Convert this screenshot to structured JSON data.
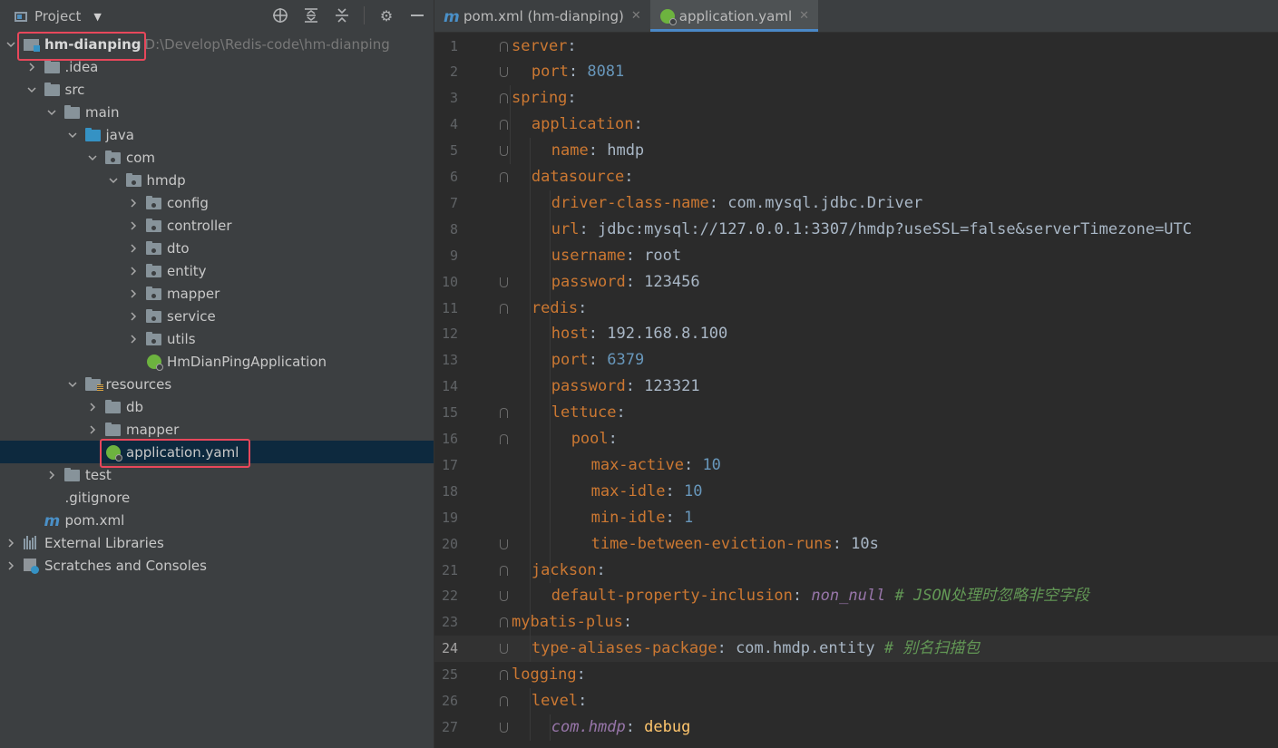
{
  "project_panel": {
    "title": "Project",
    "tree": [
      {
        "label": "hm-dianping",
        "path": "D:\\Develop\\Redis-code\\hm-dianping",
        "indent": 0,
        "arrow": "open",
        "icon": "module-folder-icon",
        "bold": true
      },
      {
        "label": ".idea",
        "indent": 1,
        "arrow": "closed",
        "icon": "folder-icon"
      },
      {
        "label": "src",
        "indent": 1,
        "arrow": "open",
        "icon": "folder-icon"
      },
      {
        "label": "main",
        "indent": 2,
        "arrow": "open",
        "icon": "folder-icon"
      },
      {
        "label": "java",
        "indent": 3,
        "arrow": "open",
        "icon": "source-folder-icon"
      },
      {
        "label": "com",
        "indent": 4,
        "arrow": "open",
        "icon": "package-icon"
      },
      {
        "label": "hmdp",
        "indent": 5,
        "arrow": "open",
        "icon": "package-icon"
      },
      {
        "label": "config",
        "indent": 6,
        "arrow": "closed",
        "icon": "package-icon"
      },
      {
        "label": "controller",
        "indent": 6,
        "arrow": "closed",
        "icon": "package-icon"
      },
      {
        "label": "dto",
        "indent": 6,
        "arrow": "closed",
        "icon": "package-icon"
      },
      {
        "label": "entity",
        "indent": 6,
        "arrow": "closed",
        "icon": "package-icon"
      },
      {
        "label": "mapper",
        "indent": 6,
        "arrow": "closed",
        "icon": "package-icon"
      },
      {
        "label": "service",
        "indent": 6,
        "arrow": "closed",
        "icon": "package-icon"
      },
      {
        "label": "utils",
        "indent": 6,
        "arrow": "closed",
        "icon": "package-icon"
      },
      {
        "label": "HmDianPingApplication",
        "indent": 6,
        "arrow": "none",
        "icon": "spring-boot-app-icon"
      },
      {
        "label": "resources",
        "indent": 3,
        "arrow": "open",
        "icon": "resources-folder-icon"
      },
      {
        "label": "db",
        "indent": 4,
        "arrow": "closed",
        "icon": "folder-icon"
      },
      {
        "label": "mapper",
        "indent": 4,
        "arrow": "closed",
        "icon": "folder-icon"
      },
      {
        "label": "application.yaml",
        "indent": 4,
        "arrow": "none",
        "icon": "spring-yaml-icon",
        "selected": true
      },
      {
        "label": "test",
        "indent": 2,
        "arrow": "closed",
        "icon": "folder-icon"
      },
      {
        "label": ".gitignore",
        "indent": 1,
        "arrow": "none",
        "icon": "gitignore-file-icon"
      },
      {
        "label": "pom.xml",
        "indent": 1,
        "arrow": "none",
        "icon": "maven-icon"
      },
      {
        "label": "External Libraries",
        "indent": 0,
        "arrow": "closed",
        "icon": "libraries-icon"
      },
      {
        "label": "Scratches and Consoles",
        "indent": 0,
        "arrow": "closed",
        "icon": "scratches-icon"
      }
    ]
  },
  "tabs": [
    {
      "label": "pom.xml (hm-dianping)",
      "icon": "maven-icon",
      "active": false
    },
    {
      "label": "application.yaml",
      "icon": "spring-yaml-icon",
      "active": true
    }
  ],
  "editor": {
    "current_line": 24,
    "lines": [
      {
        "n": "1",
        "indent": 0,
        "parts": [
          [
            "k",
            "server"
          ],
          [
            "s",
            ":"
          ]
        ]
      },
      {
        "n": "2",
        "indent": 1,
        "parts": [
          [
            "k",
            "port"
          ],
          [
            "s",
            ": "
          ],
          [
            "n",
            "8081"
          ]
        ]
      },
      {
        "n": "3",
        "indent": 0,
        "parts": [
          [
            "k",
            "spring"
          ],
          [
            "s",
            ":"
          ]
        ]
      },
      {
        "n": "4",
        "indent": 1,
        "parts": [
          [
            "k",
            "application"
          ],
          [
            "s",
            ":"
          ]
        ]
      },
      {
        "n": "5",
        "indent": 2,
        "parts": [
          [
            "k",
            "name"
          ],
          [
            "s",
            ": hmdp"
          ]
        ]
      },
      {
        "n": "6",
        "indent": 1,
        "parts": [
          [
            "k",
            "datasource"
          ],
          [
            "s",
            ":"
          ]
        ]
      },
      {
        "n": "7",
        "indent": 2,
        "parts": [
          [
            "k",
            "driver-class-name"
          ],
          [
            "s",
            ": com.mysql.jdbc.Driver"
          ]
        ]
      },
      {
        "n": "8",
        "indent": 2,
        "parts": [
          [
            "k",
            "url"
          ],
          [
            "s",
            ": jdbc:mysql://127.0.0.1:3307/hmdp?useSSL=false&serverTimezone=UTC"
          ]
        ]
      },
      {
        "n": "9",
        "indent": 2,
        "parts": [
          [
            "k",
            "username"
          ],
          [
            "s",
            ": root"
          ]
        ]
      },
      {
        "n": "10",
        "indent": 2,
        "parts": [
          [
            "k",
            "password"
          ],
          [
            "s",
            ": 123456"
          ]
        ]
      },
      {
        "n": "11",
        "indent": 1,
        "parts": [
          [
            "k",
            "redis"
          ],
          [
            "s",
            ":"
          ]
        ]
      },
      {
        "n": "12",
        "indent": 2,
        "parts": [
          [
            "k",
            "host"
          ],
          [
            "s",
            ": 192.168.8.100"
          ]
        ]
      },
      {
        "n": "13",
        "indent": 2,
        "parts": [
          [
            "k",
            "port"
          ],
          [
            "s",
            ": "
          ],
          [
            "n",
            "6379"
          ]
        ]
      },
      {
        "n": "14",
        "indent": 2,
        "parts": [
          [
            "k",
            "password"
          ],
          [
            "s",
            ": 123321"
          ]
        ]
      },
      {
        "n": "15",
        "indent": 2,
        "parts": [
          [
            "k",
            "lettuce"
          ],
          [
            "s",
            ":"
          ]
        ]
      },
      {
        "n": "16",
        "indent": 3,
        "parts": [
          [
            "k",
            "pool"
          ],
          [
            "s",
            ":"
          ]
        ]
      },
      {
        "n": "17",
        "indent": 4,
        "parts": [
          [
            "k",
            "max-active"
          ],
          [
            "s",
            ": "
          ],
          [
            "n",
            "10"
          ]
        ]
      },
      {
        "n": "18",
        "indent": 4,
        "parts": [
          [
            "k",
            "max-idle"
          ],
          [
            "s",
            ": "
          ],
          [
            "n",
            "10"
          ]
        ]
      },
      {
        "n": "19",
        "indent": 4,
        "parts": [
          [
            "k",
            "min-idle"
          ],
          [
            "s",
            ": "
          ],
          [
            "n",
            "1"
          ]
        ]
      },
      {
        "n": "20",
        "indent": 4,
        "parts": [
          [
            "k",
            "time-between-eviction-runs"
          ],
          [
            "s",
            ": 10s"
          ]
        ]
      },
      {
        "n": "21",
        "indent": 1,
        "parts": [
          [
            "k",
            "jackson"
          ],
          [
            "s",
            ":"
          ]
        ]
      },
      {
        "n": "22",
        "indent": 2,
        "parts": [
          [
            "k",
            "default-property-inclusion"
          ],
          [
            "s",
            ": "
          ],
          [
            "ital",
            "non_null"
          ],
          [
            "c",
            " # JSON处理时忽略非空字段"
          ]
        ]
      },
      {
        "n": "23",
        "indent": 0,
        "parts": [
          [
            "k",
            "mybatis-plus"
          ],
          [
            "s",
            ":"
          ]
        ]
      },
      {
        "n": "24",
        "indent": 1,
        "parts": [
          [
            "k",
            "type-aliases-package"
          ],
          [
            "s",
            ": com.hmdp.entity"
          ],
          [
            "c",
            " # 别名扫描包"
          ]
        ]
      },
      {
        "n": "25",
        "indent": 0,
        "parts": [
          [
            "k",
            "logging"
          ],
          [
            "s",
            ":"
          ]
        ]
      },
      {
        "n": "26",
        "indent": 1,
        "parts": [
          [
            "k",
            "level"
          ],
          [
            "s",
            ":"
          ]
        ]
      },
      {
        "n": "27",
        "indent": 2,
        "parts": [
          [
            "ital",
            "com.hmdp"
          ],
          [
            "s",
            ": "
          ],
          [
            "y",
            "debug"
          ]
        ]
      }
    ]
  }
}
